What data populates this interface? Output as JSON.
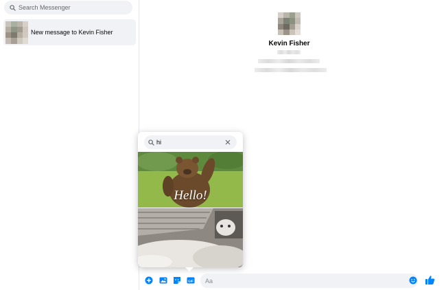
{
  "sidebar": {
    "search_placeholder": "Search Messenger",
    "conversations": [
      {
        "label": "New message to Kevin Fisher",
        "selected": true
      }
    ]
  },
  "conversation": {
    "contact_name": "Kevin Fisher"
  },
  "gif_picker": {
    "query": "hi",
    "results": [
      {
        "caption": "Hello!",
        "subject": "waving bear"
      },
      {
        "caption": "",
        "subject": "cat with fluffy blanket"
      }
    ]
  },
  "composer": {
    "placeholder": "Aa",
    "buttons": [
      "plus-icon",
      "image-icon",
      "sticker-icon",
      "gif-icon",
      "emoji-icon",
      "thumbs-up-icon"
    ]
  },
  "colors": {
    "accent": "#0084ff",
    "surface": "#f0f2f5"
  }
}
